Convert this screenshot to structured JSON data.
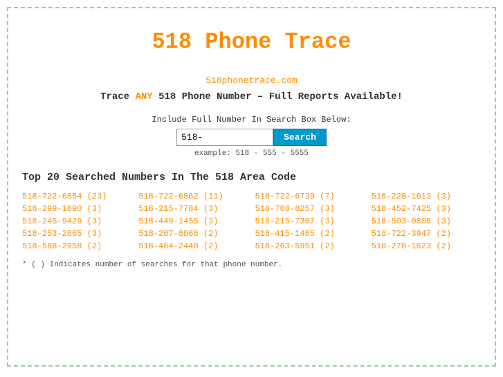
{
  "page": {
    "title": "518 Phone Trace",
    "outer_border": true
  },
  "header": {
    "title": "518 Phone Trace",
    "site_url": "518phonetrace.com",
    "tagline_prefix": "Trace ",
    "tagline_any": "ANY",
    "tagline_suffix": " 518 Phone Number – Full Reports Available!"
  },
  "search": {
    "label": "Include Full Number In Search Box Below:",
    "input_value": "518-",
    "button_label": "Search",
    "example": "example: 518 - 555 - 5555"
  },
  "top_numbers": {
    "heading": "Top 20 Searched Numbers In The 518 Area Code",
    "numbers": [
      "518-722-6854 (23)",
      "518-722-6862 (11)",
      "518-722-6739 (7)",
      "518-228-1613 (3)",
      "518-299-1090 (3)",
      "518-215-7784 (3)",
      "518-708-8257 (3)",
      "518-452-7425 (3)",
      "518-245-9429 (3)",
      "518-449-1455 (3)",
      "518-215-7307 (3)",
      "518-503-0808 (3)",
      "518-253-2865 (3)",
      "518-207-8068 (2)",
      "518-415-1485 (2)",
      "518-722-3947 (2)",
      "518-588-2958 (2)",
      "518-464-2440 (2)",
      "518-263-5951 (2)",
      "518-278-1623 (2)"
    ],
    "footnote": "* ( ) Indicates number of searches for that phone number."
  }
}
